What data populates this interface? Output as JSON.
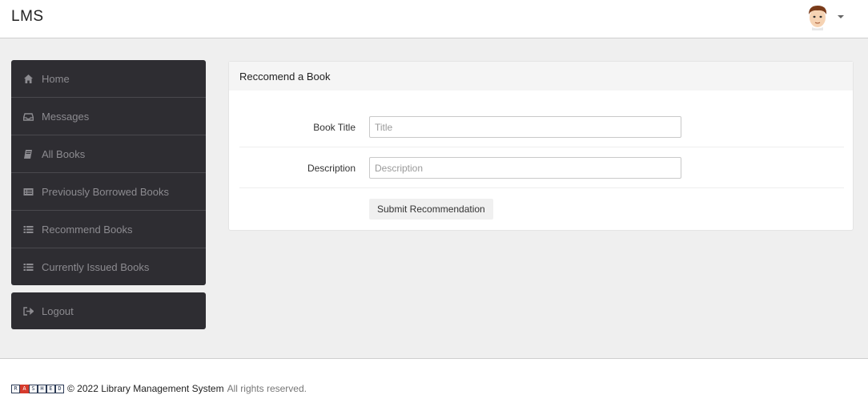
{
  "header": {
    "brand": "LMS",
    "user_avatar_icon": "avatar-icon",
    "user_menu_icon": "caret-down-icon"
  },
  "sidebar": {
    "items": [
      {
        "label": "Home",
        "icon": "home-icon"
      },
      {
        "label": "Messages",
        "icon": "inbox-icon"
      },
      {
        "label": "All Books",
        "icon": "book-icon"
      },
      {
        "label": "Previously Borrowed Books",
        "icon": "list-alt-icon"
      },
      {
        "label": "Recommend Books",
        "icon": "list-icon"
      },
      {
        "label": "Currently Issued Books",
        "icon": "list-icon"
      }
    ],
    "logout": {
      "label": "Logout",
      "icon": "sign-out-icon"
    }
  },
  "panel": {
    "title": "Reccomend a Book",
    "book_title": {
      "label": "Book Title",
      "placeholder": "Title",
      "value": ""
    },
    "description": {
      "label": "Description",
      "placeholder": "Description",
      "value": ""
    },
    "submit_label": "Submit Recommendation"
  },
  "footer": {
    "logo_letters": [
      "R",
      "A",
      "S",
      "H",
      "E",
      "D"
    ],
    "copyright": "© 2022 Library Management System",
    "rights": "All rights reserved."
  },
  "colors": {
    "sidebar_bg": "#2e2d32",
    "page_bg": "#efefef",
    "logo_red": "#d63a2c",
    "logo_navy": "#2b3a55"
  }
}
